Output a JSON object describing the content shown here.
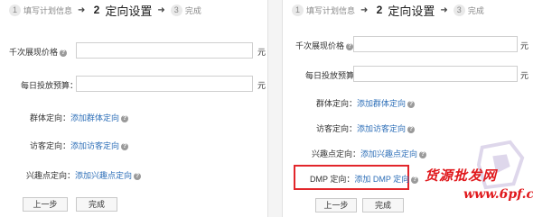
{
  "steps": [
    {
      "number": "1",
      "label": "填写计划信息"
    },
    {
      "number": "2",
      "label": "定向设置"
    },
    {
      "number": "3",
      "label": "完成"
    }
  ],
  "step_arrow": "➜",
  "fields": {
    "price_label": "千次展现价格",
    "budget_label": "每日投放预算：",
    "unit": "元"
  },
  "targeting": {
    "group_label": "群体定向：",
    "group_link": "添加群体定向",
    "visitor_label": "访客定向：",
    "visitor_link": "添加访客定向",
    "interest_label": "兴趣点定向：",
    "interest_link": "添加兴趣点定向",
    "dmp_label": "DMP 定向：",
    "dmp_link": "添加 DMP 定向"
  },
  "help_icon_glyph": "?",
  "buttons": {
    "prev": "上一步",
    "finish": "完成"
  },
  "watermark": {
    "text": "货源批发网",
    "url": "www.6pf.cn"
  },
  "colors": {
    "link": "#2e6fb8",
    "highlight": "#e2262b"
  }
}
